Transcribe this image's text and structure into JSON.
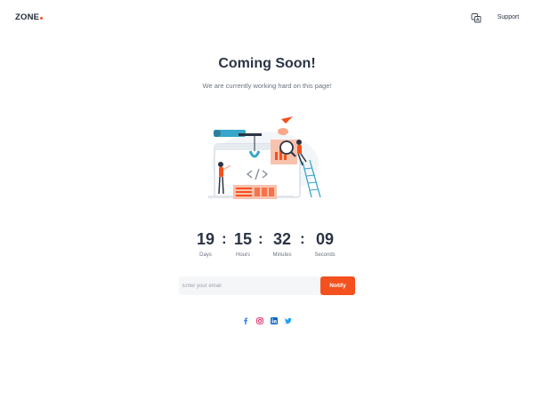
{
  "header": {
    "logo_text": "ZONE",
    "language_icon": "translate-icon",
    "support_label": "Support"
  },
  "hero": {
    "title": "Coming Soon!",
    "subtitle": "We are currently working hard on this page!"
  },
  "countdown": [
    {
      "value": "19",
      "label": "Days"
    },
    {
      "value": "15",
      "label": "Hours"
    },
    {
      "value": "32",
      "label": "Minutes"
    },
    {
      "value": "09",
      "label": "Seconds"
    }
  ],
  "subscribe": {
    "placeholder": "Enter your email",
    "button_label": "Notify"
  },
  "social": [
    {
      "name": "facebook-icon",
      "color": "#1877f2"
    },
    {
      "name": "instagram-icon",
      "color": "#e1306c"
    },
    {
      "name": "linkedin-icon",
      "color": "#0a66c2"
    },
    {
      "name": "twitter-icon",
      "color": "#1da1f2"
    }
  ],
  "colors": {
    "accent": "#f4511e",
    "text": "#2b3445",
    "muted": "#6b7280",
    "illustration_blue": "#3aa6c9",
    "illustration_peach": "#f8a98a"
  }
}
